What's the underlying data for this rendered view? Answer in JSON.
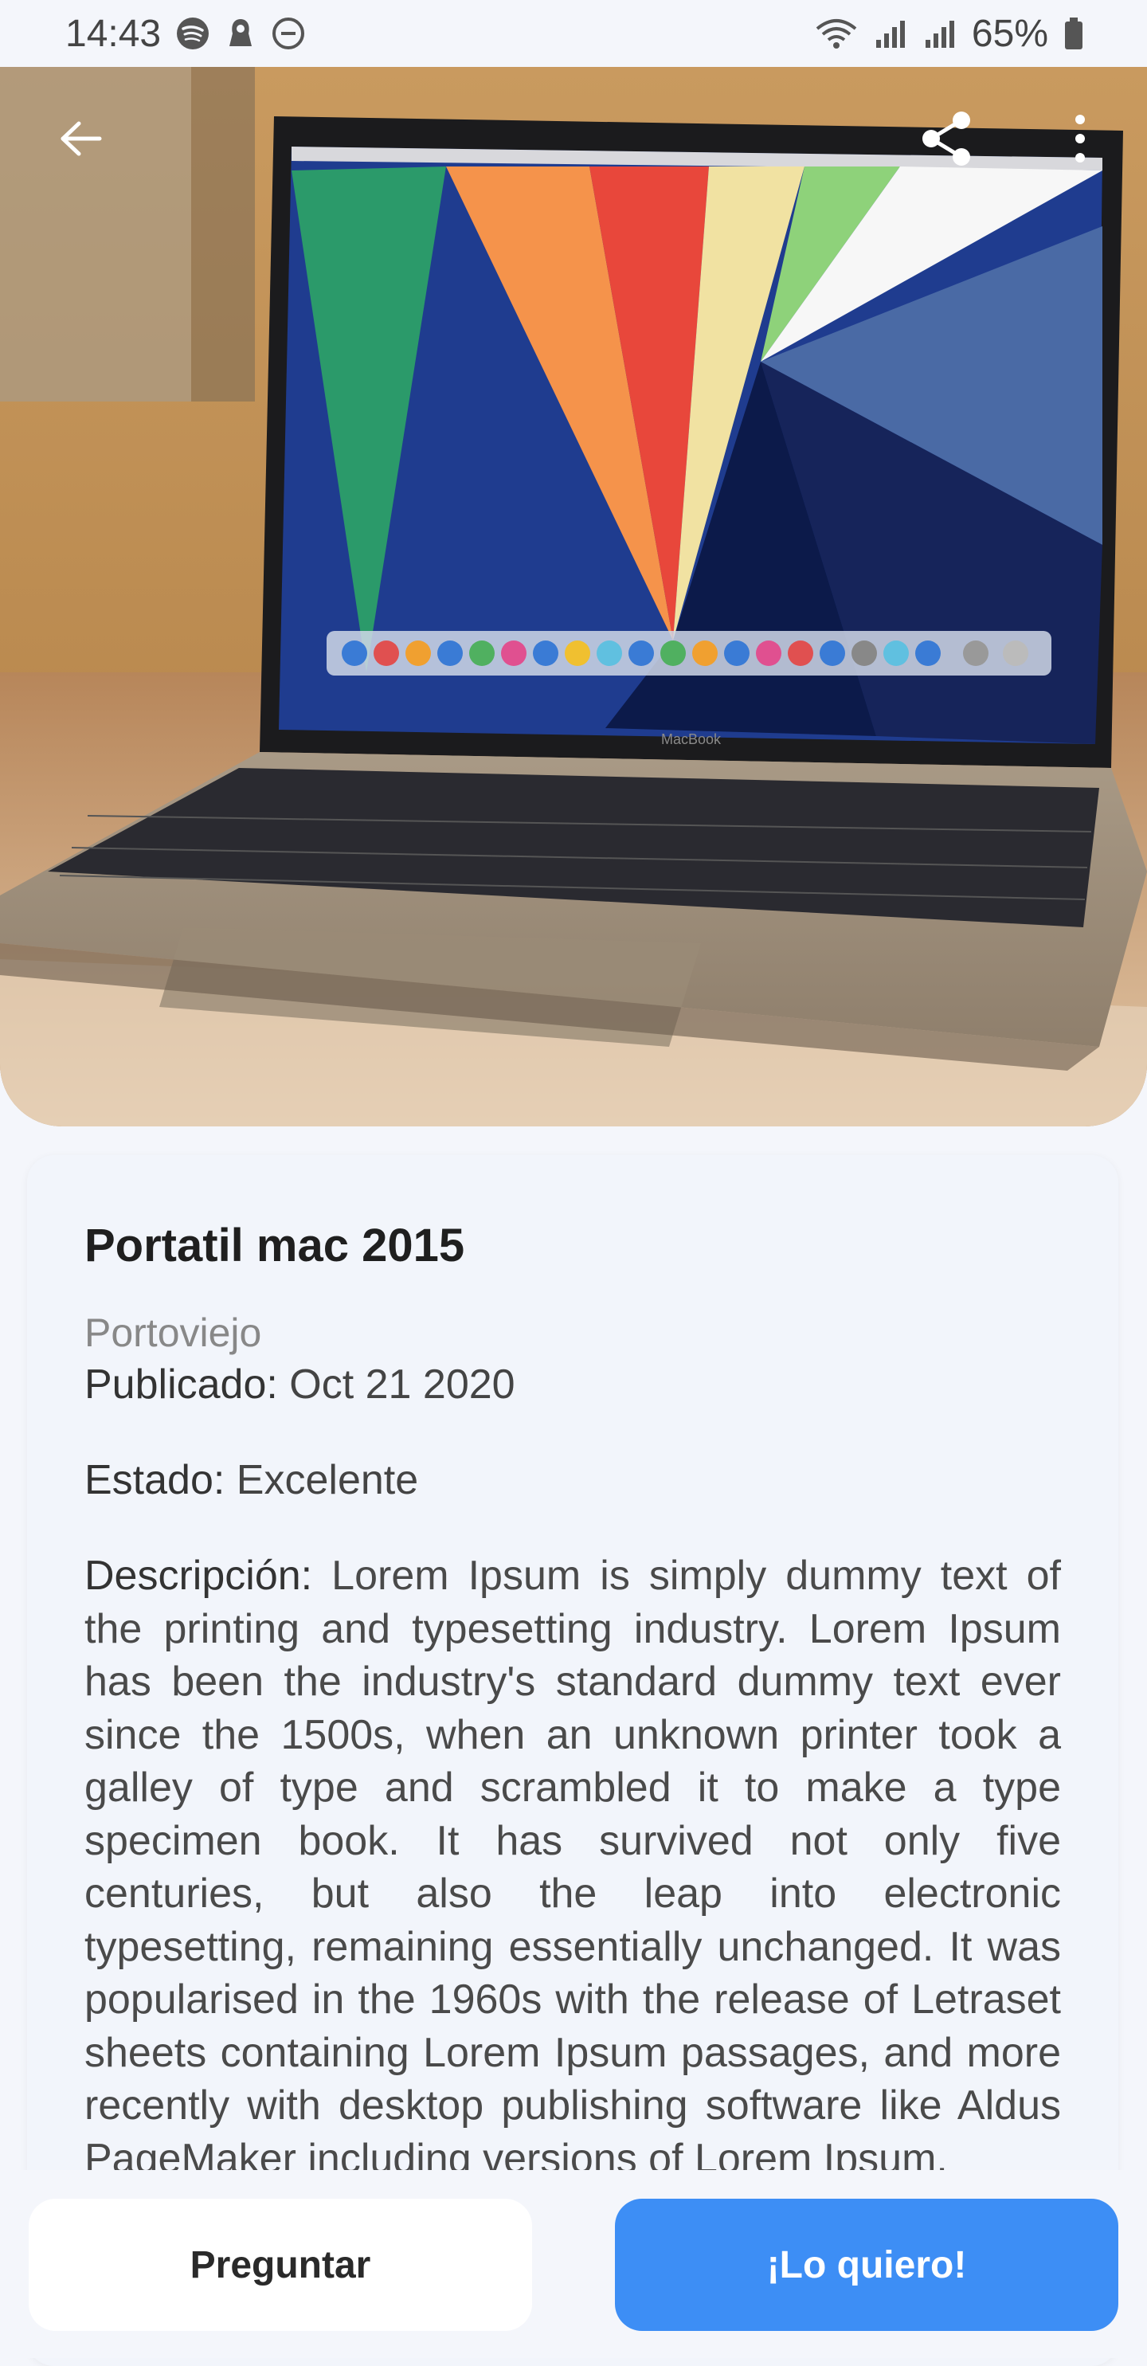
{
  "status_bar": {
    "time": "14:43",
    "battery": "65%",
    "icons_left": [
      "spotify-icon",
      "fingerprint-icon",
      "do-not-disturb-icon"
    ],
    "icons_right": [
      "wifi-icon",
      "signal-icon",
      "signal-icon",
      "battery-icon"
    ]
  },
  "header": {
    "back_icon": "arrow-left-icon",
    "share_icon": "share-icon",
    "more_icon": "more-vertical-icon"
  },
  "product": {
    "title": "Portatil mac 2015",
    "location": "Portoviejo",
    "published_label": "Publicado:",
    "published_value": "Oct 21 2020",
    "estado_label": "Estado:",
    "estado_value": "Excelente",
    "description_label": "Descripción:",
    "description_text": "Lorem Ipsum is simply dummy text of the printing and typesetting industry. Lorem Ipsum has been the industry's standard dummy text ever since the 1500s, when an unknown printer took a galley of type and scrambled it to make a type specimen book. It has survived not only five centuries, but also the leap into electronic typesetting, remaining essentially unchanged. It was popularised in the 1960s with the release of Letraset sheets containing Lorem Ipsum passages, and more recently with desktop publishing software like Aldus PageMaker including versions of Lorem Ipsum.",
    "laptop_brand": "MacBook"
  },
  "actions": {
    "ask_label": "Preguntar",
    "want_label": "¡Lo quiero!"
  },
  "colors": {
    "accent": "#3d8ef5",
    "background": "#f4f6fb"
  }
}
